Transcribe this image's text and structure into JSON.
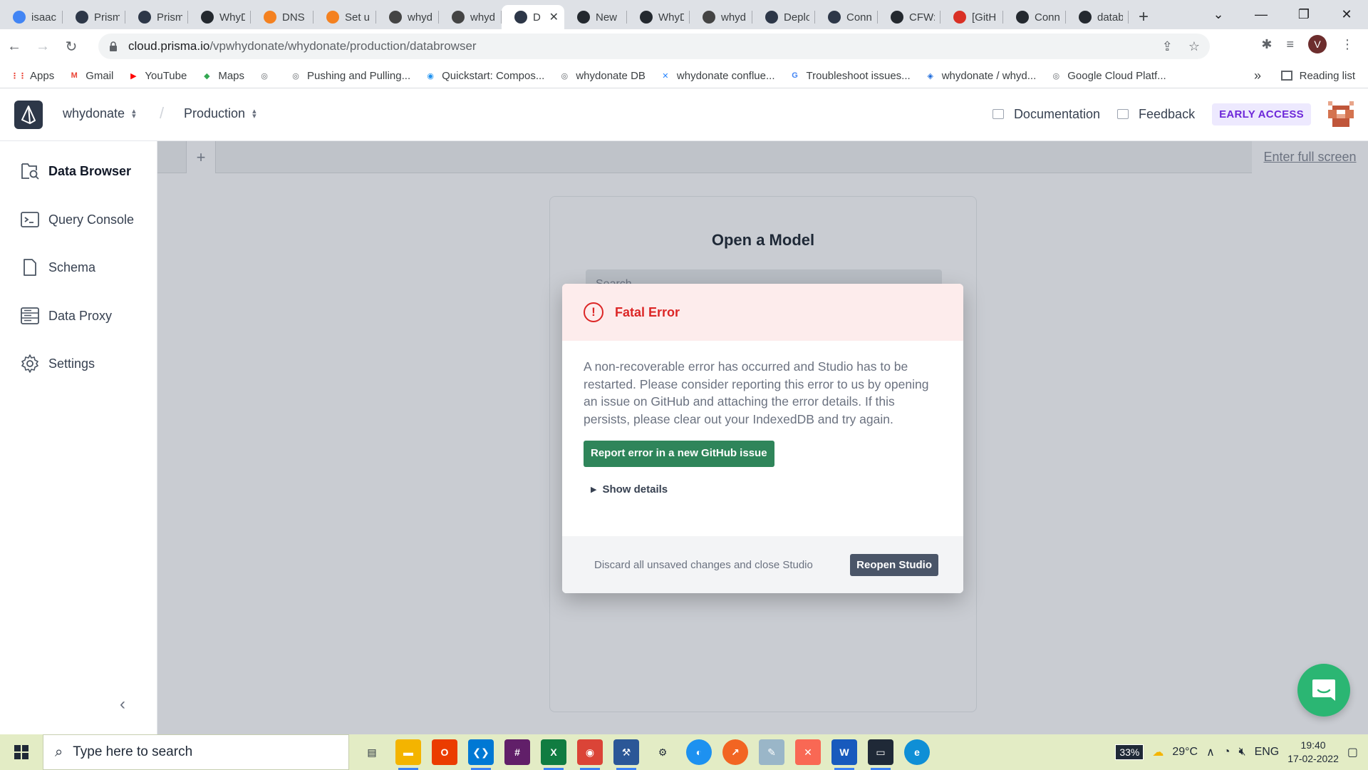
{
  "browser": {
    "tabs": [
      {
        "title": "isaac",
        "icon_color": "#4285f4"
      },
      {
        "title": "Prism",
        "icon_color": "#2d3748"
      },
      {
        "title": "Prism",
        "icon_color": "#2d3748"
      },
      {
        "title": "WhyD",
        "icon_color": "#24292f"
      },
      {
        "title": "DNS",
        "icon_color": "#f48120"
      },
      {
        "title": "Set u",
        "icon_color": "#f48120"
      },
      {
        "title": "whyd",
        "icon_color": "#444"
      },
      {
        "title": "whyd",
        "icon_color": "#444"
      },
      {
        "title": "D",
        "icon_color": "#2d3748"
      },
      {
        "title": "New",
        "icon_color": "#24292f"
      },
      {
        "title": "WhyD",
        "icon_color": "#24292f"
      },
      {
        "title": "whyd",
        "icon_color": "#444"
      },
      {
        "title": "Deplo",
        "icon_color": "#2d3748"
      },
      {
        "title": "Conn",
        "icon_color": "#2d3748"
      },
      {
        "title": "CFW:",
        "icon_color": "#24292f"
      },
      {
        "title": "[GitH",
        "icon_color": "#d93025"
      },
      {
        "title": "Conn",
        "icon_color": "#24292f"
      },
      {
        "title": "datab",
        "icon_color": "#24292f"
      }
    ],
    "url_host": "cloud.prisma.io",
    "url_path": "/vpwhydonate/whydonate/production/databrowser",
    "profile_initial": "V",
    "bookmarks": [
      {
        "label": "Apps",
        "color": "#ea4335",
        "glyph": "⋮⋮"
      },
      {
        "label": "Gmail",
        "color": "#ea4335",
        "glyph": "M"
      },
      {
        "label": "YouTube",
        "color": "#ff0000",
        "glyph": "▶"
      },
      {
        "label": "Maps",
        "color": "#34a853",
        "glyph": "◆"
      },
      {
        "label": "",
        "color": "#5f6368",
        "glyph": "◎"
      },
      {
        "label": "Pushing and Pulling...",
        "color": "#5f6368",
        "glyph": "◎"
      },
      {
        "label": "Quickstart: Compos...",
        "color": "#1d91f0",
        "glyph": "◉"
      },
      {
        "label": "whydonate DB",
        "color": "#5f6368",
        "glyph": "◎"
      },
      {
        "label": "whydonate conflue...",
        "color": "#2684ff",
        "glyph": "✕"
      },
      {
        "label": "Troubleshoot issues...",
        "color": "#4285f4",
        "glyph": "G"
      },
      {
        "label": "whydonate / whyd...",
        "color": "#1868db",
        "glyph": "◈"
      },
      {
        "label": "Google Cloud Platf...",
        "color": "#5f6368",
        "glyph": "◎"
      }
    ],
    "bookmarks_more": "»",
    "reading_list": "Reading list"
  },
  "app": {
    "project": "whydonate",
    "environment": "Production",
    "documentation": "Documentation",
    "feedback": "Feedback",
    "early_access": "EARLY ACCESS"
  },
  "sidebar": {
    "items": [
      {
        "label": "Data Browser",
        "icon": "data-browser-icon"
      },
      {
        "label": "Query Console",
        "icon": "terminal-icon"
      },
      {
        "label": "Schema",
        "icon": "document-icon"
      },
      {
        "label": "Data Proxy",
        "icon": "server-icon"
      },
      {
        "label": "Settings",
        "icon": "gear-icon"
      }
    ]
  },
  "main": {
    "add_tab": "+",
    "full_screen": "Enter full screen",
    "open_model_title": "Open a Model",
    "search_placeholder": "Search..."
  },
  "modal": {
    "title": "Fatal Error",
    "message": "A non-recoverable error has occurred and Studio has to be restarted. Please consider reporting this error to us by opening an issue on GitHub and attaching the error details. If this persists, please clear out your IndexedDB and try again.",
    "report_button": "Report error in a new GitHub issue",
    "show_details": "Show details",
    "discard": "Discard all unsaved changes and close Studio",
    "reopen_button": "Reopen Studio"
  },
  "taskbar": {
    "search_placeholder": "Type here to search",
    "battery": "33%",
    "temperature": "29°C",
    "language": "ENG",
    "time": "19:40",
    "date": "17-02-2022"
  }
}
